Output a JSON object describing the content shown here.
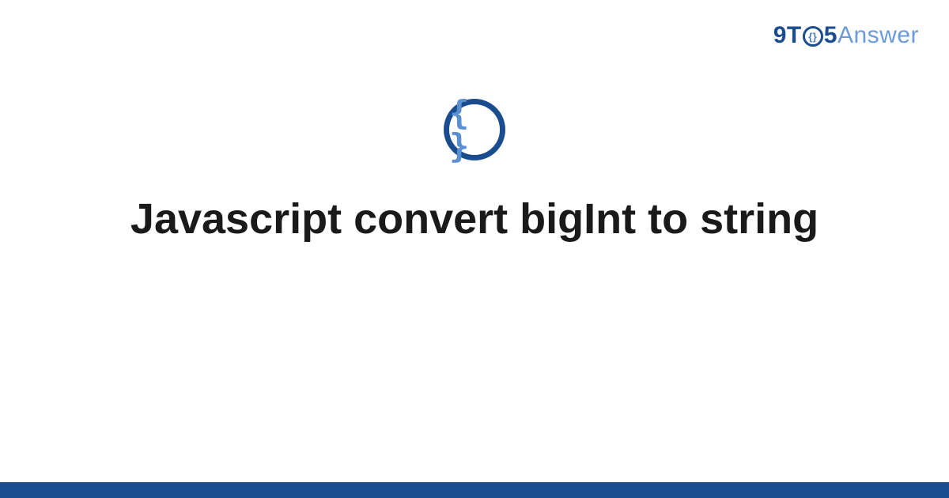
{
  "header": {
    "logo_part1": "9T",
    "logo_o_inner": "{}",
    "logo_part2": "5",
    "logo_part3": "Answer"
  },
  "icon": {
    "name": "code-braces-icon",
    "glyph": "{ }"
  },
  "title": "Javascript convert bigInt to string",
  "colors": {
    "brand_dark": "#1a4d8f",
    "brand_light": "#6b9bd8",
    "text": "#1a1a1a"
  }
}
